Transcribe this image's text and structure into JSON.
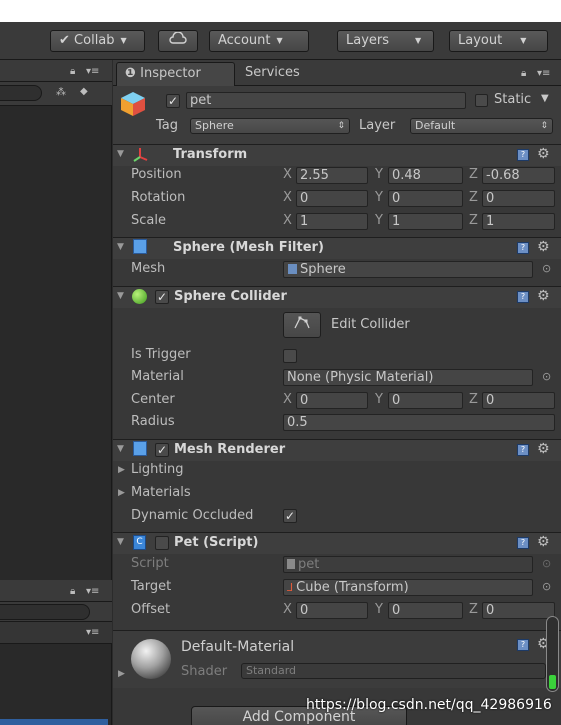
{
  "toolbar": {
    "collab_label": "Collab",
    "account_label": "Account",
    "layers_label": "Layers",
    "layout_label": "Layout"
  },
  "tabs": [
    {
      "label": "Inspector",
      "active": true
    },
    {
      "label": "Services",
      "active": false
    }
  ],
  "object": {
    "name": "pet",
    "static_label": "Static",
    "tag_label": "Tag",
    "tag_value": "Sphere",
    "layer_label": "Layer",
    "layer_value": "Default"
  },
  "transform": {
    "title": "Transform",
    "position_label": "Position",
    "position": {
      "x": "2.55",
      "y": "0.48",
      "z": "-0.68"
    },
    "rotation_label": "Rotation",
    "rotation": {
      "x": "0",
      "y": "0",
      "z": "0"
    },
    "scale_label": "Scale",
    "scale": {
      "x": "1",
      "y": "1",
      "z": "1"
    }
  },
  "mesh_filter": {
    "title": "Sphere (Mesh Filter)",
    "mesh_label": "Mesh",
    "mesh_value": "Sphere"
  },
  "sphere_collider": {
    "title": "Sphere Collider",
    "edit_label": "Edit Collider",
    "is_trigger_label": "Is Trigger",
    "material_label": "Material",
    "material_value": "None (Physic Material)",
    "center_label": "Center",
    "center": {
      "x": "0",
      "y": "0",
      "z": "0"
    },
    "radius_label": "Radius",
    "radius_value": "0.5"
  },
  "mesh_renderer": {
    "title": "Mesh Renderer",
    "lighting_label": "Lighting",
    "materials_label": "Materials",
    "dynamic_occluded_label": "Dynamic Occluded"
  },
  "pet_script": {
    "title": "Pet (Script)",
    "script_label": "Script",
    "script_value": "pet",
    "target_label": "Target",
    "target_value": "Cube (Transform)",
    "offset_label": "Offset",
    "offset": {
      "x": "0",
      "y": "0",
      "z": "0"
    }
  },
  "material": {
    "name": "Default-Material",
    "shader_label": "Shader",
    "shader_value": "Standard"
  },
  "axes": {
    "x": "X",
    "y": "Y",
    "z": "Z"
  },
  "add_component_label": "Add Component",
  "watermark": "https://blog.csdn.net/qq_42986916",
  "colors": {
    "accent_green": "#3bd23b",
    "panel_bg": "#383838",
    "header_bg": "#3e3e3e"
  }
}
